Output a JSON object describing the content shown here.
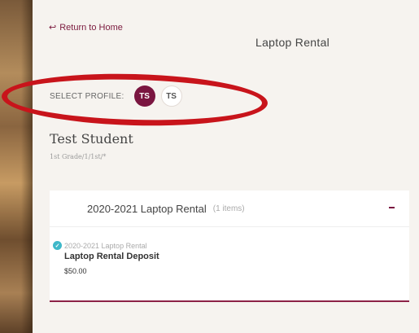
{
  "nav": {
    "back_arrow": "↩",
    "back_label": "Return to Home"
  },
  "page": {
    "title": "Laptop Rental"
  },
  "profile": {
    "label": "SELECT PROFILE:",
    "options": [
      {
        "initials": "TS",
        "selected": true
      },
      {
        "initials": "TS",
        "selected": false
      }
    ]
  },
  "student": {
    "name": "Test Student",
    "meta": "1st Grade/1/1st/*"
  },
  "rental_group": {
    "title": "2020-2021 Laptop Rental",
    "count": "(1 items)",
    "collapse_icon": "minus-icon",
    "items": [
      {
        "category": "2020-2021 Laptop Rental",
        "name": "Laptop Rental Deposit",
        "price": "$50.00",
        "status_icon": "check-circle-icon"
      }
    ]
  },
  "colors": {
    "brand": "#7a1540",
    "highlight": "#c8141b",
    "check": "#3fb8c9",
    "background": "#f6f3ef"
  }
}
